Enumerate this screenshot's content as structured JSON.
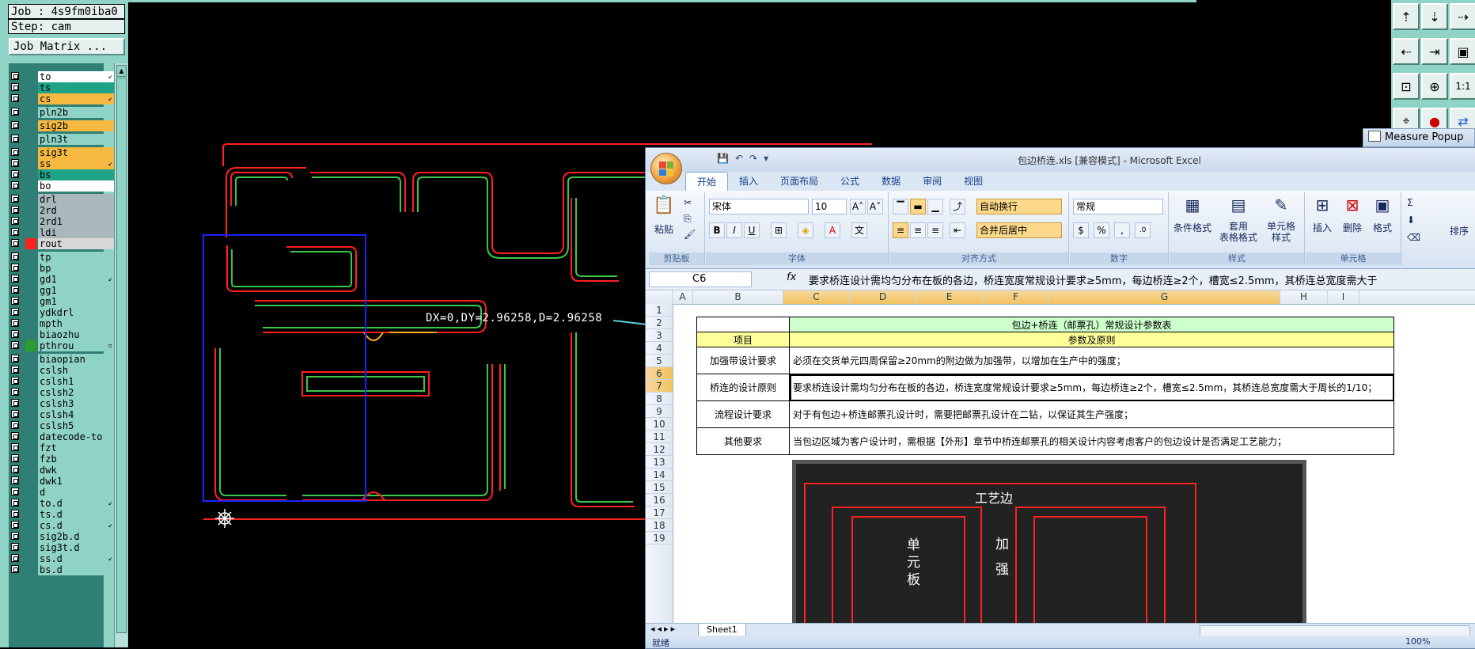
{
  "cam": {
    "job_line": "Job : 4s9fm0iba0",
    "step_line": "Step: cam",
    "job_matrix_label": "Job Matrix ...",
    "measure_readout": "DX=0,DY=2.96258,D=2.96258",
    "layers": [
      {
        "name": "to",
        "color": "#ffffff",
        "flag": "↙"
      },
      {
        "name": "ts",
        "color": "#1fa386",
        "flag": ""
      },
      {
        "name": "cs",
        "color": "#f5b942",
        "flag": "↙"
      },
      {
        "name": "pln2b",
        "color": "#8fd3c7",
        "flag": ""
      },
      {
        "name": "sig2b",
        "color": "#f5b942",
        "flag": ""
      },
      {
        "name": "pln3t",
        "color": "#8fd3c7",
        "flag": ""
      },
      {
        "name": "sig3t",
        "color": "#f5b942",
        "flag": ""
      },
      {
        "name": "ss",
        "color": "#f5b942",
        "flag": "↙"
      },
      {
        "name": "bs",
        "color": "#1fa386",
        "flag": ""
      },
      {
        "name": "bo",
        "color": "#ffffff",
        "flag": ""
      },
      {
        "name": "drl",
        "color": "#a9b8bd",
        "flag": ""
      },
      {
        "name": "2rd",
        "color": "#a9b8bd",
        "flag": ""
      },
      {
        "name": "2rd1",
        "color": "#a9b8bd",
        "flag": ""
      },
      {
        "name": "ldi",
        "color": "#a9b8bd",
        "flag": ""
      },
      {
        "name": "rout",
        "color": "#d8d8d8",
        "flag": ""
      },
      {
        "name": "tp",
        "color": "#8fd3c7",
        "flag": ""
      },
      {
        "name": "bp",
        "color": "#8fd3c7",
        "flag": ""
      },
      {
        "name": "gd1",
        "color": "#8fd3c7",
        "flag": "↙"
      },
      {
        "name": "gg1",
        "color": "#8fd3c7",
        "flag": ""
      },
      {
        "name": "gm1",
        "color": "#8fd3c7",
        "flag": ""
      },
      {
        "name": "ydkdrl",
        "color": "#8fd3c7",
        "flag": ""
      },
      {
        "name": "mpth",
        "color": "#8fd3c7",
        "flag": ""
      },
      {
        "name": "biaozhu",
        "color": "#8fd3c7",
        "flag": ""
      },
      {
        "name": "pthrou",
        "color": "#8fd3c7",
        "flag": "▫"
      },
      {
        "name": "biaopian",
        "color": "#8fd3c7",
        "flag": ""
      },
      {
        "name": "cslsh",
        "color": "#8fd3c7",
        "flag": ""
      },
      {
        "name": "cslsh1",
        "color": "#8fd3c7",
        "flag": ""
      },
      {
        "name": "cslsh2",
        "color": "#8fd3c7",
        "flag": ""
      },
      {
        "name": "cslsh3",
        "color": "#8fd3c7",
        "flag": ""
      },
      {
        "name": "cslsh4",
        "color": "#8fd3c7",
        "flag": ""
      },
      {
        "name": "cslsh5",
        "color": "#8fd3c7",
        "flag": ""
      },
      {
        "name": "datecode-to",
        "color": "#8fd3c7",
        "flag": ""
      },
      {
        "name": "fzt",
        "color": "#8fd3c7",
        "flag": ""
      },
      {
        "name": "fzb",
        "color": "#8fd3c7",
        "flag": ""
      },
      {
        "name": "dwk",
        "color": "#8fd3c7",
        "flag": ""
      },
      {
        "name": "dwk1",
        "color": "#8fd3c7",
        "flag": ""
      },
      {
        "name": "d",
        "color": "#8fd3c7",
        "flag": ""
      },
      {
        "name": "to.d",
        "color": "#8fd3c7",
        "flag": "↙"
      },
      {
        "name": "ts.d",
        "color": "#8fd3c7",
        "flag": ""
      },
      {
        "name": "cs.d",
        "color": "#8fd3c7",
        "flag": "↙"
      },
      {
        "name": "sig2b.d",
        "color": "#8fd3c7",
        "flag": ""
      },
      {
        "name": "sig3t.d",
        "color": "#8fd3c7",
        "flag": ""
      },
      {
        "name": "ss.d",
        "color": "#8fd3c7",
        "flag": "↙"
      },
      {
        "name": "bs.d",
        "color": "#8fd3c7",
        "flag": ""
      }
    ]
  },
  "measure_popup": {
    "title": "Measure Popup"
  },
  "excel": {
    "title": "包边桥连.xls  [兼容模式] - Microsoft Excel",
    "tabs": [
      "开始",
      "插入",
      "页面布局",
      "公式",
      "数据",
      "审阅",
      "视图"
    ],
    "active_tab": "开始",
    "groups": {
      "clipboard": {
        "label": "剪贴板",
        "paste": "粘贴"
      },
      "font": {
        "label": "字体",
        "font_name": "宋体",
        "font_size": "10"
      },
      "alignment": {
        "label": "对齐方式",
        "wrap": "自动换行",
        "merge": "合并后居中"
      },
      "number": {
        "label": "数字",
        "format": "常规"
      },
      "styles": {
        "label": "样式",
        "cond": "条件格式",
        "table": "套用\n表格格式",
        "cell": "单元格\n样式"
      },
      "cells": {
        "label": "单元格",
        "insert": "插入",
        "delete": "删除",
        "format": "格式"
      },
      "editing": {
        "label": "排序"
      }
    },
    "name_box": "C6",
    "formula": "要求桥连设计需均匀分布在板的各边，桥连宽度常规设计要求≥5mm，每边桥连≥2个，槽宽≤2.5mm，其桥连总宽度需大于",
    "columns": [
      {
        "label": "A",
        "sel": false
      },
      {
        "label": "B",
        "sel": false
      },
      {
        "label": "C",
        "sel": true
      },
      {
        "label": "D",
        "sel": true
      },
      {
        "label": "E",
        "sel": true
      },
      {
        "label": "F",
        "sel": true
      },
      {
        "label": "G",
        "sel": true
      },
      {
        "label": "H",
        "sel": false
      },
      {
        "label": "I",
        "sel": false
      }
    ],
    "rows": [
      "1",
      "2",
      "3",
      "4",
      "5",
      "6",
      "7",
      "8",
      "9",
      "10",
      "11",
      "12",
      "13",
      "14",
      "15",
      "16",
      "17",
      "18",
      "19"
    ],
    "table": {
      "title": "包边+桥连（邮票孔）常规设计参数表",
      "head_item": "项目",
      "head_param": "参数及原则",
      "rows": [
        {
          "item": "加强带设计要求",
          "text": "必须在交货单元四周保留≥20mm的附边做为加强带，以增加在生产中的强度；"
        },
        {
          "item": "桥连的设计原则",
          "text": "要求桥连设计需均匀分布在板的各边，桥连宽度常规设计要求≥5mm，每边桥连≥2个，槽宽≤2.5mm，其桥连总宽度需大于周长的1/10；"
        },
        {
          "item": "流程设计要求",
          "text": "对于有包边+桥连邮票孔设计时，需要把邮票孔设计在二钻，以保证其生产强度；"
        },
        {
          "item": "其他要求",
          "text": "当包边区域为客户设计时，需根据【外形】章节中桥连邮票孔的相关设计内容考虑客户的包边设计是否满足工艺能力；"
        }
      ]
    },
    "image_text": {
      "top": "工艺边",
      "left": "单元板",
      "mid": "加强"
    },
    "sheet_tab": "Sheet1",
    "status": "就绪",
    "zoom": "100%"
  }
}
